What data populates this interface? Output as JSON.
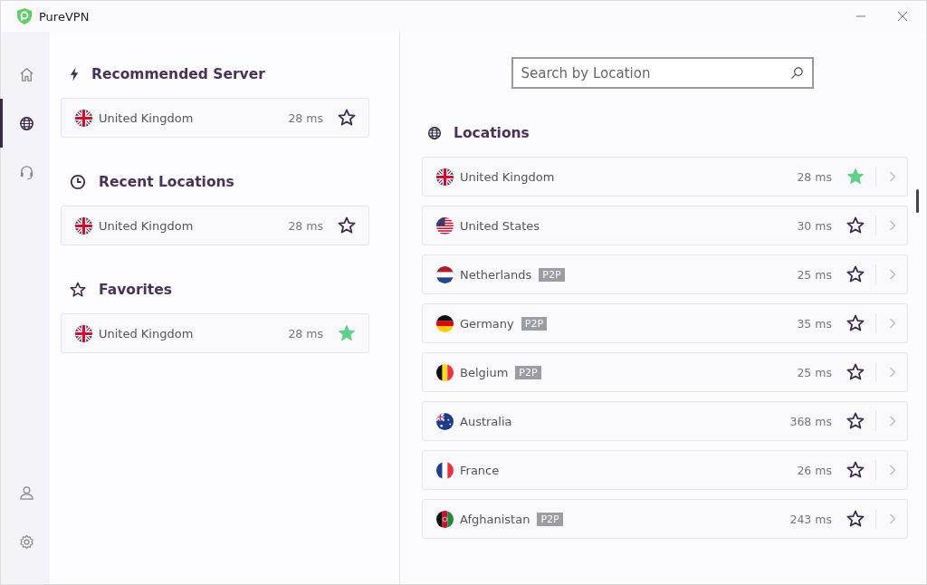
{
  "window": {
    "title": "PureVPN"
  },
  "nav": {
    "top": [
      {
        "kind": "home",
        "selected": false
      },
      {
        "kind": "globe",
        "selected": true
      },
      {
        "kind": "support",
        "selected": false
      }
    ],
    "bottom": [
      {
        "kind": "account",
        "selected": false
      },
      {
        "kind": "settings",
        "selected": false
      }
    ]
  },
  "sections": [
    {
      "kind": "bolt",
      "title": "Recommended Server",
      "items": [
        {
          "kind": "gb",
          "name": "United Kingdom",
          "ping": "28 ms",
          "favorite": false
        }
      ]
    },
    {
      "kind": "clock",
      "title": "Recent Locations",
      "items": [
        {
          "kind": "gb",
          "name": "United Kingdom",
          "ping": "28 ms",
          "favorite": false
        }
      ]
    },
    {
      "kind": "star",
      "title": "Favorites",
      "items": [
        {
          "kind": "gb",
          "name": "United Kingdom",
          "ping": "28 ms",
          "favorite": true
        }
      ]
    }
  ],
  "search": {
    "placeholder": "Search by Location"
  },
  "locations": {
    "title": "Locations",
    "items": [
      {
        "kind": "gb",
        "name": "United Kingdom",
        "ping": "28 ms",
        "favorite": true
      },
      {
        "kind": "us",
        "name": "United States",
        "ping": "30 ms",
        "favorite": false
      },
      {
        "kind": "nl",
        "name": "Netherlands",
        "tag": "P2P",
        "ping": "25 ms",
        "favorite": false
      },
      {
        "kind": "de",
        "name": "Germany",
        "tag": "P2P",
        "ping": "35 ms",
        "favorite": false
      },
      {
        "kind": "be",
        "name": "Belgium",
        "tag": "P2P",
        "ping": "25 ms",
        "favorite": false
      },
      {
        "kind": "au",
        "name": "Australia",
        "ping": "368 ms",
        "favorite": false
      },
      {
        "kind": "fr",
        "name": "France",
        "ping": "26 ms",
        "favorite": false
      },
      {
        "kind": "af",
        "name": "Afghanistan",
        "tag": "P2P",
        "ping": "243 ms",
        "favorite": false
      }
    ]
  }
}
